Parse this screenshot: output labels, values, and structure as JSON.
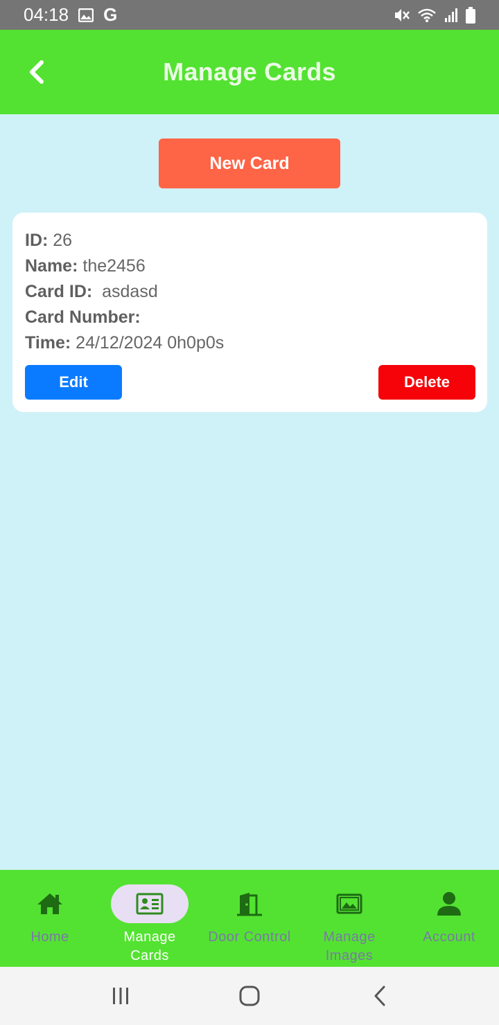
{
  "status_bar": {
    "time": "04:18",
    "g_label": "G",
    "icons": [
      "image-icon",
      "google-icon",
      "mute-icon",
      "wifi-icon",
      "signal-icon",
      "battery-icon"
    ]
  },
  "app_bar": {
    "title": "Manage Cards",
    "back_icon": "chevron-left-icon"
  },
  "actions": {
    "new_card_label": "New Card"
  },
  "cards": [
    {
      "id_label": "ID:",
      "id_value": " 26",
      "name_label": "Name:",
      "name_value": " the2456",
      "card_id_label": "Card ID:",
      "card_id_value": "  asdasd",
      "card_number_label": "Card Number:",
      "card_number_value": "",
      "time_label": "Time:",
      "time_value": " 24/12/2024 0h0p0s",
      "edit_label": "Edit",
      "delete_label": "Delete"
    }
  ],
  "bottom_nav": {
    "items": [
      {
        "label": "Home",
        "icon": "home-icon",
        "active": false
      },
      {
        "label": "Manage\nCards",
        "icon": "id-card-icon",
        "active": true
      },
      {
        "label": "Door Control",
        "icon": "door-icon",
        "active": false
      },
      {
        "label": "Manage\nImages",
        "icon": "image-icon",
        "active": false
      },
      {
        "label": "Account",
        "icon": "account-icon",
        "active": false
      }
    ]
  },
  "colors": {
    "app_bar": "#53e231",
    "background": "#cff2f8",
    "new_card": "#fe6446",
    "edit": "#0a7bff",
    "delete": "#f50308",
    "nav_icon": "#1e6b14",
    "active_pill": "#e8dff4"
  }
}
